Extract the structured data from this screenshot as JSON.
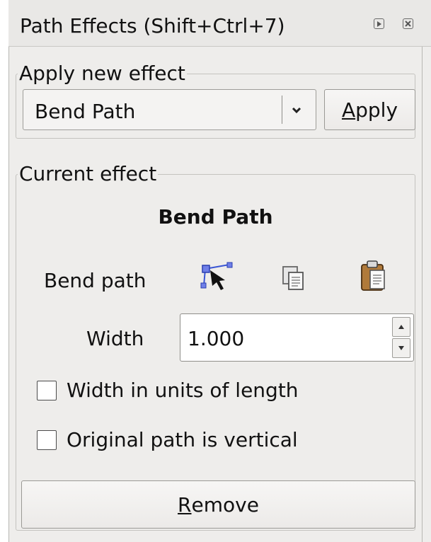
{
  "window": {
    "title": "Path Effects (Shift+Ctrl+7)",
    "icons": [
      "dock-icon",
      "close-icon"
    ]
  },
  "apply_new_effect": {
    "legend": "Apply new effect",
    "selected_effect": "Bend Path",
    "apply_accel": "A",
    "apply_rest": "pply"
  },
  "current_effect": {
    "legend": "Current effect",
    "effect_name": "Bend Path",
    "bend_path_label": "Bend path",
    "bend_path_icons": [
      "edit-path-icon",
      "copy-path-icon",
      "paste-path-icon"
    ],
    "width_label": "Width",
    "width_value": "1.000",
    "checkboxes": [
      {
        "label": "Width in units of length",
        "checked": false
      },
      {
        "label": "Original path is vertical",
        "checked": false
      }
    ],
    "remove_accel": "R",
    "remove_rest": "emove"
  }
}
